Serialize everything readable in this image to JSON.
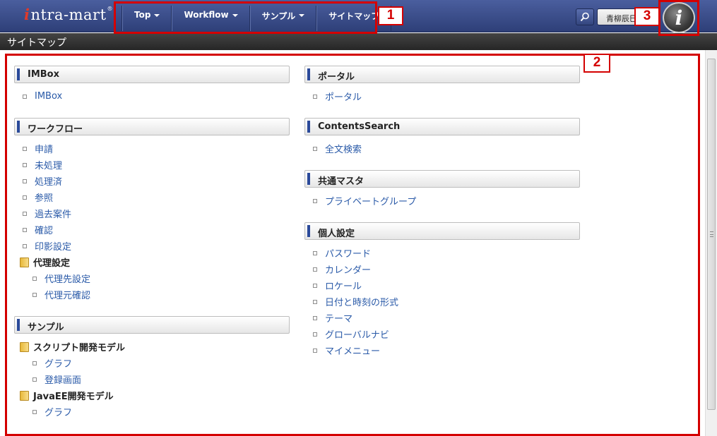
{
  "header": {
    "logo_prefix": "i",
    "logo_text": "ntra-mart",
    "logo_reg": "®",
    "nav": [
      {
        "label": "Top"
      },
      {
        "label": "Workflow"
      },
      {
        "label": "サンプル"
      },
      {
        "label": "サイトマップ"
      }
    ],
    "user_name": "青柳辰巳",
    "im_logo_glyph": "i"
  },
  "page_title": "サイトマップ",
  "annotations": [
    "1",
    "2",
    "3"
  ],
  "left_column": {
    "sections": [
      {
        "title": "IMBox",
        "items": [
          {
            "label": "IMBox"
          }
        ]
      },
      {
        "title": "ワークフロー",
        "items": [
          {
            "label": "申請"
          },
          {
            "label": "未処理"
          },
          {
            "label": "処理済"
          },
          {
            "label": "参照"
          },
          {
            "label": "過去案件"
          },
          {
            "label": "確認"
          },
          {
            "label": "印影設定"
          }
        ],
        "folder": {
          "label": "代理設定",
          "items": [
            {
              "label": "代理先設定"
            },
            {
              "label": "代理元確認"
            }
          ]
        }
      },
      {
        "title": "サンプル",
        "folders": [
          {
            "label": "スクリプト開発モデル",
            "items": [
              {
                "label": "グラフ"
              },
              {
                "label": "登録画面"
              }
            ]
          },
          {
            "label": "JavaEE開発モデル",
            "items": [
              {
                "label": "グラフ"
              }
            ]
          }
        ]
      }
    ]
  },
  "right_column": {
    "sections": [
      {
        "title": "ポータル",
        "items": [
          {
            "label": "ポータル"
          }
        ]
      },
      {
        "title": "ContentsSearch",
        "items": [
          {
            "label": "全文検索"
          }
        ]
      },
      {
        "title": "共通マスタ",
        "items": [
          {
            "label": "プライベートグループ"
          }
        ]
      },
      {
        "title": "個人設定",
        "items": [
          {
            "label": "パスワード"
          },
          {
            "label": "カレンダー"
          },
          {
            "label": "ロケール"
          },
          {
            "label": "日付と時刻の形式"
          },
          {
            "label": "テーマ"
          },
          {
            "label": "グローバルナビ"
          },
          {
            "label": "マイメニュー"
          }
        ]
      }
    ]
  },
  "colors": {
    "accent": "#2b4a9a",
    "link": "#2a5aa8",
    "annotation": "#d40000",
    "header": "#3a4c8a"
  }
}
